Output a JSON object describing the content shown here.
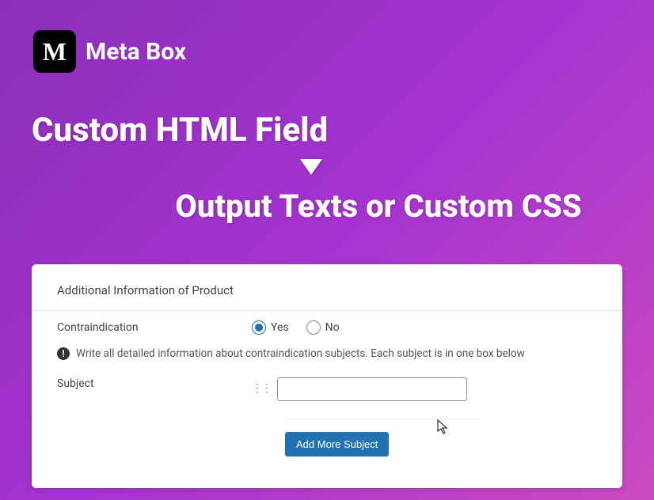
{
  "brand": {
    "logo_letter": "M",
    "name": "Meta Box"
  },
  "headings": {
    "line1": "Custom HTML Field",
    "line2": "Output Texts or Custom CSS"
  },
  "panel": {
    "title": "Additional Information of Product",
    "contraindication": {
      "label": "Contraindication",
      "yes": "Yes",
      "no": "No"
    },
    "info_text": "Write all detailed information about contraindication subjects. Each subject is in one box below",
    "subject": {
      "label": "Subject",
      "value": ""
    },
    "add_button": "Add More Subject"
  }
}
